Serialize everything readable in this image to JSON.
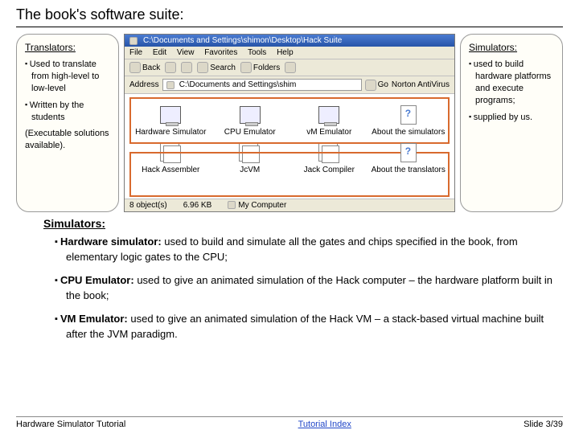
{
  "title": "The book's software suite:",
  "translators": {
    "heading": "Translators:",
    "b1": "Used to translate from high-level to low-level",
    "b2": "Written by the students",
    "paren": "(Executable solutions available)."
  },
  "simulators_call": {
    "heading": "Simulators:",
    "b1": "used to build hardware platforms and execute programs;",
    "b2": "supplied by us."
  },
  "explorer": {
    "title": "C:\\Documents and Settings\\shimon\\Desktop\\Hack Suite",
    "menu": {
      "file": "File",
      "edit": "Edit",
      "view": "View",
      "fav": "Favorites",
      "tools": "Tools",
      "help": "Help"
    },
    "tool": {
      "back": "Back",
      "search": "Search",
      "folders": "Folders"
    },
    "addr_label": "Address",
    "addr_value": "C:\\Documents and Settings\\shim",
    "go": "Go",
    "norton": "Norton AntiVirus",
    "row1": {
      "a": "Hardware Simulator",
      "b": "CPU Emulator",
      "c": "vM Emulator",
      "d": "About the simulators"
    },
    "row2": {
      "a": "Hack Assembler",
      "b": "JcVM",
      "c": "Jack Compiler",
      "d": "About the translators"
    },
    "status_objs": "8 object(s)",
    "status_size": "6.96 KB",
    "status_loc": "My Computer"
  },
  "section_head": "Simulators:",
  "main_bullets": {
    "b1_bold": "Hardware simulator:",
    "b1_rest": " used to build and simulate all the gates and chips specified in the book, from elementary logic gates to the CPU;",
    "b2_bold": "CPU Emulator:",
    "b2_rest": " used to give an animated simulation of the Hack computer – the hardware platform built in the book;",
    "b3_bold": "VM Emulator:",
    "b3_rest": " used to give an animated simulation of the Hack VM – a stack-based virtual machine built after the JVM paradigm."
  },
  "footer": {
    "left": "Hardware Simulator Tutorial",
    "center": "Tutorial Index",
    "right": "Slide 3/39"
  }
}
